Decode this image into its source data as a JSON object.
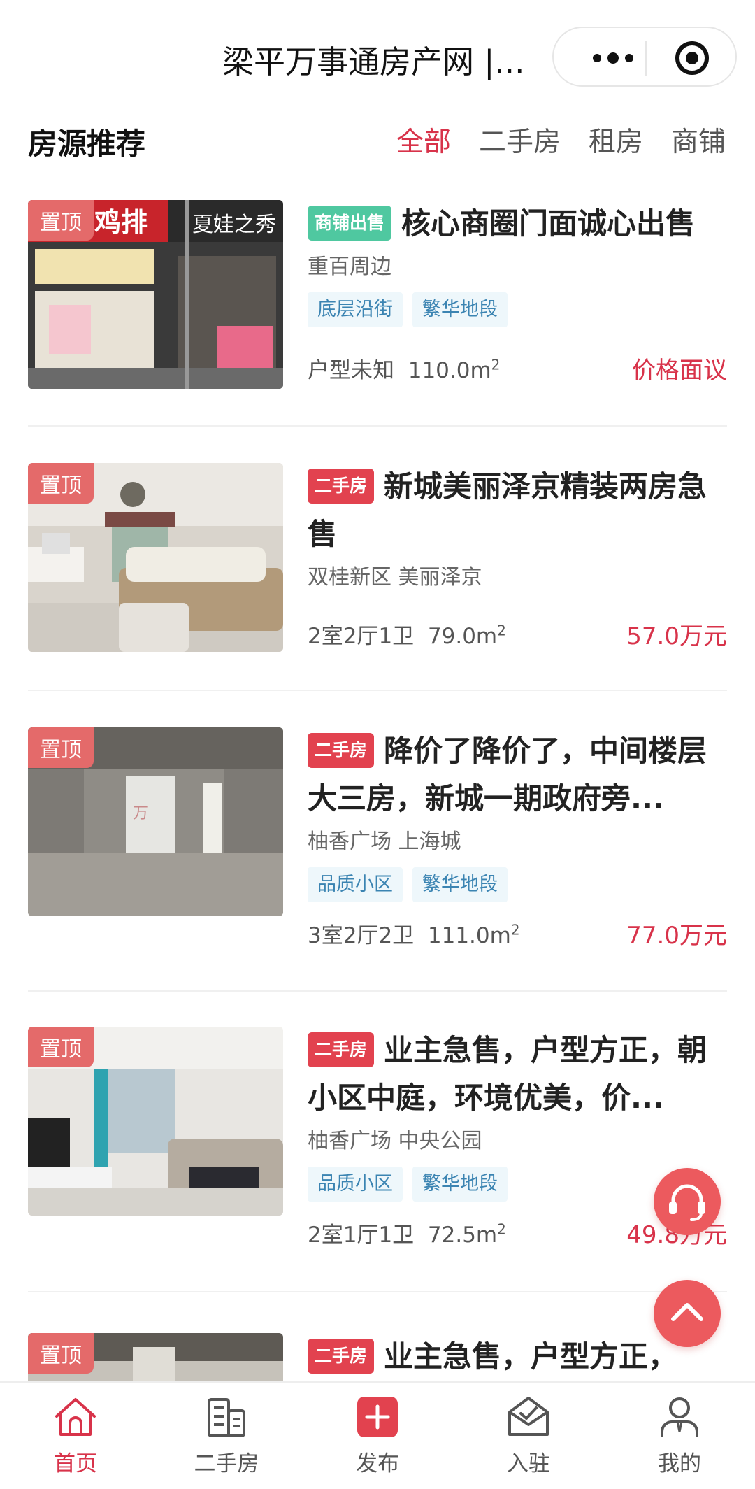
{
  "header": {
    "title": "梁平万事通房产网 |..."
  },
  "section": {
    "title": "房源推荐",
    "tabs": [
      {
        "label": "全部",
        "active": true
      },
      {
        "label": "二手房",
        "active": false
      },
      {
        "label": "租房",
        "active": false
      },
      {
        "label": "商铺",
        "active": false
      }
    ]
  },
  "listings": [
    {
      "pin": "置顶",
      "badge": "商铺出售",
      "title": "核心商圈门面诚心出售",
      "location": "重百周边",
      "tags": [
        "底层沿街",
        "繁华地段"
      ],
      "layout": "户型未知",
      "area": "110.0m",
      "area_unit": "2",
      "price": "价格面议"
    },
    {
      "pin": "置顶",
      "badge": "二手房",
      "title": "新城美丽泽京精装两房急售",
      "location": "双桂新区 美丽泽京",
      "tags": [],
      "layout": "2室2厅1卫",
      "area": "79.0m",
      "area_unit": "2",
      "price": "57.0万元"
    },
    {
      "pin": "置顶",
      "badge": "二手房",
      "title": "降价了降价了，中间楼层大三房，新城一期政府旁...",
      "location": "柚香广场 上海城",
      "tags": [
        "品质小区",
        "繁华地段"
      ],
      "layout": "3室2厅2卫",
      "area": "111.0m",
      "area_unit": "2",
      "price": "77.0万元"
    },
    {
      "pin": "置顶",
      "badge": "二手房",
      "title": "业主急售，户型方正，朝小区中庭，环境优美，价...",
      "location": "柚香广场 中央公园",
      "tags": [
        "品质小区",
        "繁华地段"
      ],
      "layout": "2室1厅1卫",
      "area": "72.5m",
      "area_unit": "2",
      "price": "49.8万元"
    },
    {
      "pin": "置顶",
      "badge": "二手房",
      "title": "业主急售，户型方正，"
    }
  ],
  "tabbar": [
    {
      "label": "首页",
      "icon": "home-icon",
      "active": true
    },
    {
      "label": "二手房",
      "icon": "building-icon",
      "active": false
    },
    {
      "label": "发布",
      "icon": "plus-icon",
      "active": false
    },
    {
      "label": "入驻",
      "icon": "inbox-check-icon",
      "active": false
    },
    {
      "label": "我的",
      "icon": "user-icon",
      "active": false
    }
  ],
  "colors": {
    "accent": "#d8334a",
    "shop_badge": "#4fc8a0",
    "used_badge": "#e2424f",
    "pin": "#e46a6a",
    "tag_text": "#3b84b2"
  }
}
